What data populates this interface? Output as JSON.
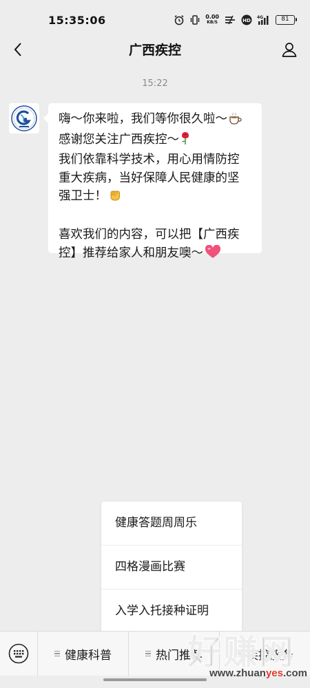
{
  "status_bar": {
    "time": "15:35:06",
    "net_speed_value": "0.00",
    "net_speed_unit": "KB/S",
    "network_type": "4G",
    "hd_badge": "HD",
    "battery_level": "81",
    "icons": [
      "alarm-icon",
      "vibrate-icon",
      "net-speed",
      "wifi-slash-icon",
      "hd-icon",
      "signal-icon",
      "battery-icon"
    ]
  },
  "nav": {
    "title": "广西疾控",
    "back_icon": "chevron-left-icon",
    "profile_icon": "person-icon"
  },
  "chat": {
    "timestamp": "15:22",
    "message": {
      "avatar_icon": "cdc-logo",
      "lines": [
        "嗨～你来啦，我们等你很久啦～",
        "感谢您关注广西疾控～",
        "我们依靠科学技术，用心用情防控",
        "重大疾病，当好保障人民健康的坚",
        "强卫士！",
        "喜欢我们的内容，可以把【广西疾",
        "控】推荐给家人和朋友噢～"
      ],
      "emojis": [
        "coffee-emoji",
        "rose-emoji",
        "fist-emoji",
        "heart-emoji"
      ]
    }
  },
  "popup_menu": {
    "items": [
      "健康答题周周乐",
      "四格漫画比赛",
      "入学入托接种证明"
    ]
  },
  "bottom_menu": {
    "keyboard_icon": "keyboard-icon",
    "tabs": [
      "健康科普",
      "热门推荐",
      "疾控服务"
    ]
  },
  "watermark": {
    "title": "好赚网",
    "url_prefix": "www.zhuan",
    "url_highlight": "yes",
    "url_suffix": ".com"
  },
  "colors": {
    "background": "#ededed",
    "bubble": "#ffffff",
    "heart": "#f0507a",
    "watermark_accent": "#e23a2e"
  }
}
